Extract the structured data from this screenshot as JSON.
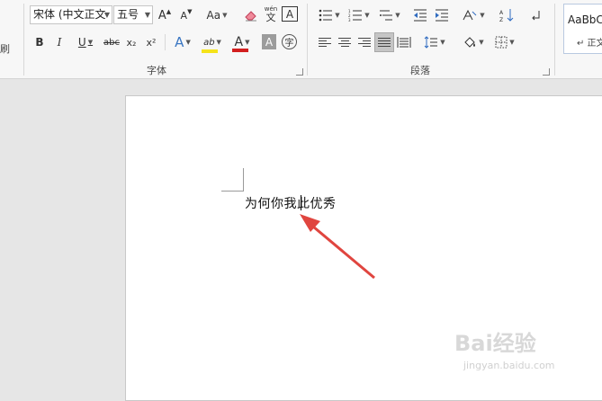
{
  "ribbon": {
    "clipboard_partial_label": "刷",
    "font_group": {
      "label": "字体",
      "font_name": "宋体 (中文正文",
      "font_size": "五号",
      "grow_label": "A",
      "shrink_label": "A",
      "case_label": "Aa",
      "phonetic_top": "wén",
      "phonetic_bottom": "文",
      "char_border_label": "A",
      "bold": "B",
      "italic": "I",
      "underline": "U",
      "strike": "abc",
      "subscript": "x₂",
      "superscript": "x²",
      "effects_label": "A",
      "highlight_label": "ab",
      "font_color_label": "A",
      "shading_label": "A",
      "enclose_label": "字"
    },
    "paragraph_group": {
      "label": "段落"
    },
    "styles_group": {
      "preview": "AaBbC",
      "name": "↵ 正文"
    }
  },
  "document": {
    "text": "为何你我此优秀"
  },
  "watermark": {
    "brand": "Bai经验",
    "url": "jingyan.baidu.com"
  },
  "colors": {
    "highlight": "#f5e31a",
    "font_color": "#d21f1f",
    "arrow": "#e0453f"
  }
}
